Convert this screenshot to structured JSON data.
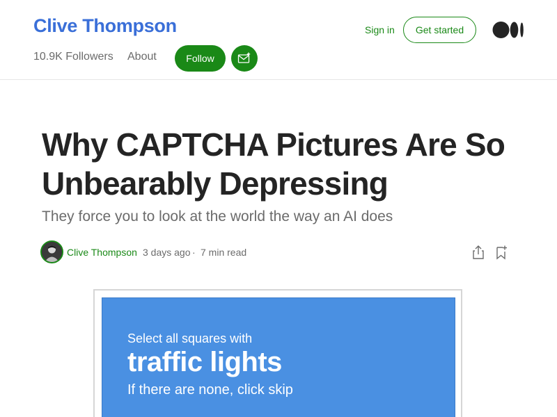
{
  "header": {
    "publication_title": "Clive Thompson",
    "followers": "10.9K Followers",
    "about": "About",
    "follow_label": "Follow",
    "sign_in": "Sign in",
    "get_started": "Get started"
  },
  "article": {
    "title": "Why CAPTCHA Pictures Are So Unbearably Depressing",
    "subtitle": "They force you to look at the world the way an AI does",
    "author": "Clive Thompson",
    "published": "3 days ago",
    "separator": "·",
    "read_time": "7 min read"
  },
  "figure": {
    "line1": "Select all squares with",
    "line2": "traffic lights",
    "line3": "If there are none, click skip"
  },
  "colors": {
    "brand_green": "#1a8917",
    "title_blue": "#3a6fd8",
    "captcha_blue": "#4a90e2"
  },
  "icons": [
    "subscribe-mail-icon",
    "medium-logo-icon",
    "share-icon",
    "bookmark-add-icon"
  ]
}
